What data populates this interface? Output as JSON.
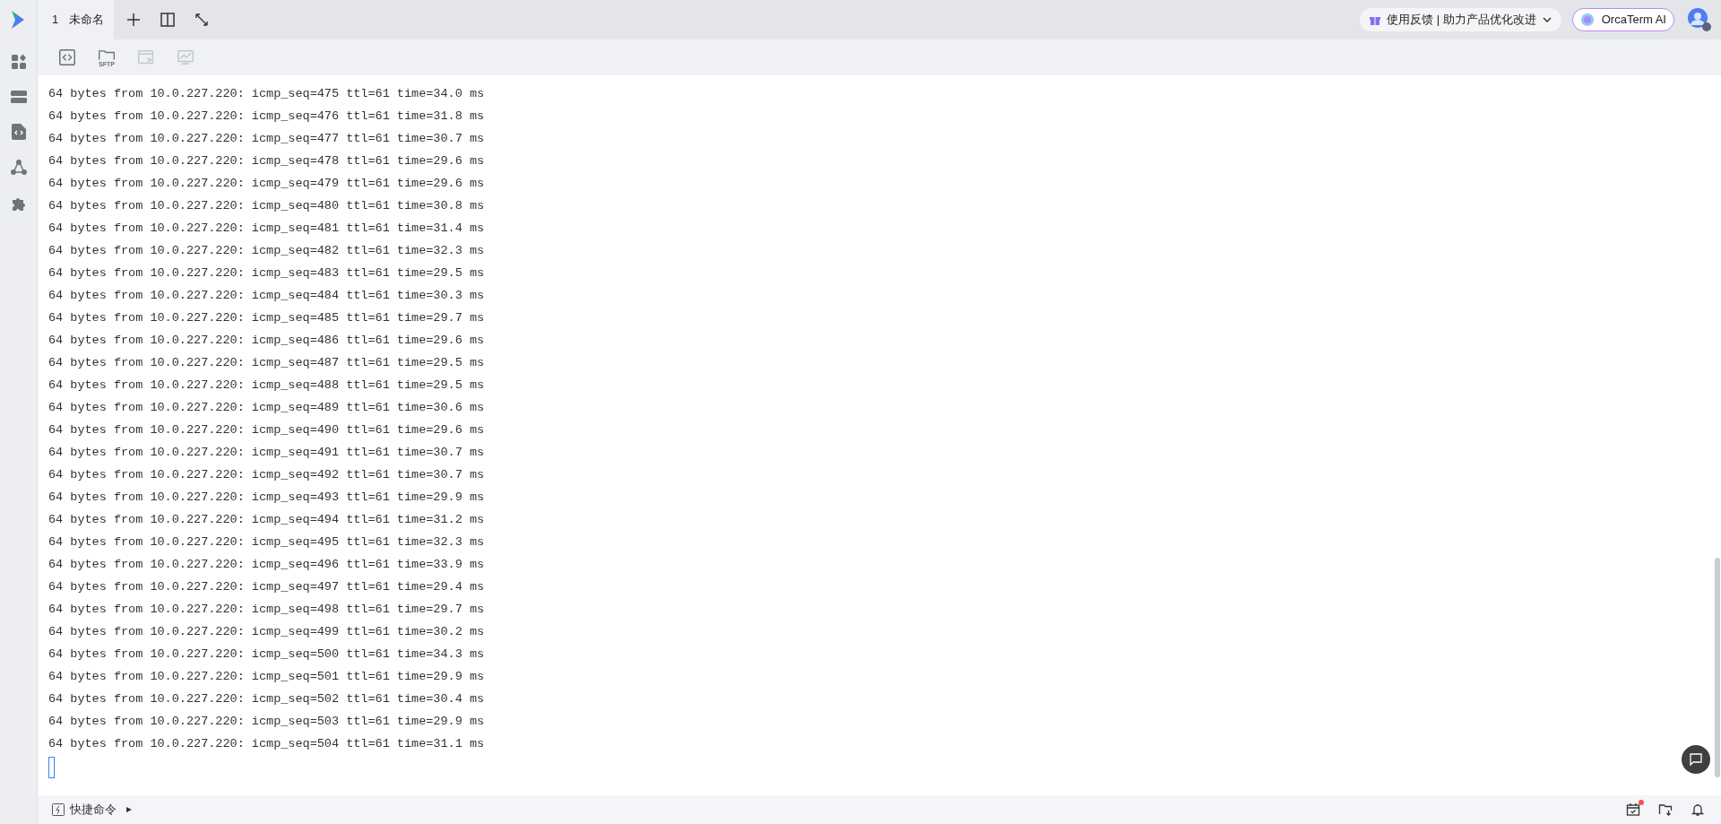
{
  "tabs": [
    {
      "number": "1",
      "title": "未命名",
      "selected": true
    }
  ],
  "feedback": {
    "label": "使用反馈 | 助力产品优化改进"
  },
  "ai_button": {
    "label": "OrcaTerm AI"
  },
  "toolbar": [
    {
      "kind": "code",
      "disabled": false
    },
    {
      "kind": "sftp",
      "label": "SFTP",
      "disabled": false
    },
    {
      "kind": "window",
      "disabled": true
    },
    {
      "kind": "monitor",
      "disabled": true
    }
  ],
  "terminal": {
    "lines": [
      "64 bytes from 10.0.227.220: icmp_seq=475 ttl=61 time=34.0 ms",
      "64 bytes from 10.0.227.220: icmp_seq=476 ttl=61 time=31.8 ms",
      "64 bytes from 10.0.227.220: icmp_seq=477 ttl=61 time=30.7 ms",
      "64 bytes from 10.0.227.220: icmp_seq=478 ttl=61 time=29.6 ms",
      "64 bytes from 10.0.227.220: icmp_seq=479 ttl=61 time=29.6 ms",
      "64 bytes from 10.0.227.220: icmp_seq=480 ttl=61 time=30.8 ms",
      "64 bytes from 10.0.227.220: icmp_seq=481 ttl=61 time=31.4 ms",
      "64 bytes from 10.0.227.220: icmp_seq=482 ttl=61 time=32.3 ms",
      "64 bytes from 10.0.227.220: icmp_seq=483 ttl=61 time=29.5 ms",
      "64 bytes from 10.0.227.220: icmp_seq=484 ttl=61 time=30.3 ms",
      "64 bytes from 10.0.227.220: icmp_seq=485 ttl=61 time=29.7 ms",
      "64 bytes from 10.0.227.220: icmp_seq=486 ttl=61 time=29.6 ms",
      "64 bytes from 10.0.227.220: icmp_seq=487 ttl=61 time=29.5 ms",
      "64 bytes from 10.0.227.220: icmp_seq=488 ttl=61 time=29.5 ms",
      "64 bytes from 10.0.227.220: icmp_seq=489 ttl=61 time=30.6 ms",
      "64 bytes from 10.0.227.220: icmp_seq=490 ttl=61 time=29.6 ms",
      "64 bytes from 10.0.227.220: icmp_seq=491 ttl=61 time=30.7 ms",
      "64 bytes from 10.0.227.220: icmp_seq=492 ttl=61 time=30.7 ms",
      "64 bytes from 10.0.227.220: icmp_seq=493 ttl=61 time=29.9 ms",
      "64 bytes from 10.0.227.220: icmp_seq=494 ttl=61 time=31.2 ms",
      "64 bytes from 10.0.227.220: icmp_seq=495 ttl=61 time=32.3 ms",
      "64 bytes from 10.0.227.220: icmp_seq=496 ttl=61 time=33.9 ms",
      "64 bytes from 10.0.227.220: icmp_seq=497 ttl=61 time=29.4 ms",
      "64 bytes from 10.0.227.220: icmp_seq=498 ttl=61 time=29.7 ms",
      "64 bytes from 10.0.227.220: icmp_seq=499 ttl=61 time=30.2 ms",
      "64 bytes from 10.0.227.220: icmp_seq=500 ttl=61 time=34.3 ms",
      "64 bytes from 10.0.227.220: icmp_seq=501 ttl=61 time=29.9 ms",
      "64 bytes from 10.0.227.220: icmp_seq=502 ttl=61 time=30.4 ms",
      "64 bytes from 10.0.227.220: icmp_seq=503 ttl=61 time=29.9 ms",
      "64 bytes from 10.0.227.220: icmp_seq=504 ttl=61 time=31.1 ms"
    ]
  },
  "bottom_bar": {
    "quick_commands": "快捷命令",
    "calendar_notification": true
  }
}
